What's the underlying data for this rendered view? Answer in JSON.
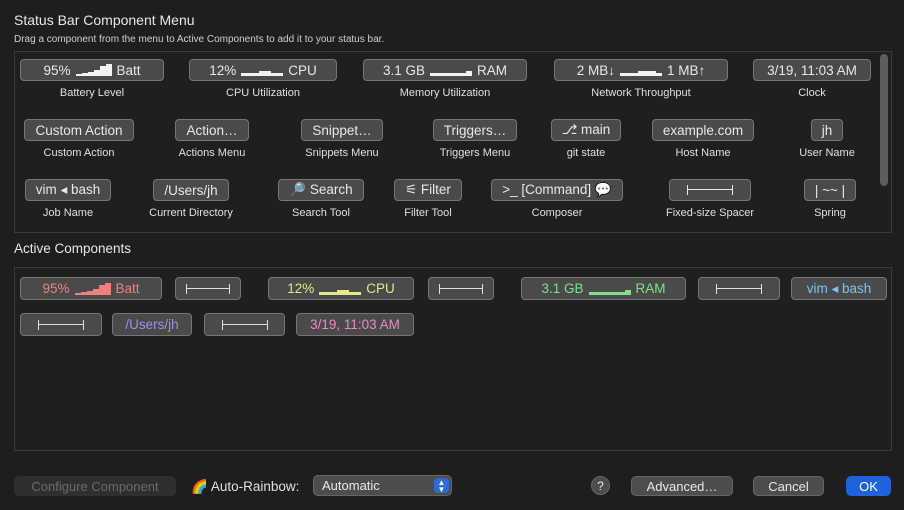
{
  "header": {
    "title": "Status Bar Component Menu",
    "subtitle": "Drag a component from the menu to Active Components to add it to your status bar."
  },
  "menu": {
    "row1": [
      {
        "display_left": "95%",
        "display_right": "Batt",
        "caption": "Battery Level"
      },
      {
        "display_left": "12%",
        "display_right": "CPU",
        "caption": "CPU Utilization"
      },
      {
        "display_left": "3.1 GB",
        "display_right": "RAM",
        "caption": "Memory Utilization"
      },
      {
        "display_left": "2 MB↓",
        "display_right": "1 MB↑",
        "caption": "Network Throughput"
      },
      {
        "display": "3/19, 11:03 AM",
        "caption": "Clock"
      }
    ],
    "row2": [
      {
        "display": "Custom Action",
        "caption": "Custom Action"
      },
      {
        "display": "Action…",
        "caption": "Actions Menu"
      },
      {
        "display": "Snippet…",
        "caption": "Snippets Menu"
      },
      {
        "display": "Triggers…",
        "caption": "Triggers Menu"
      },
      {
        "display": "⎇ main",
        "caption": "git state"
      },
      {
        "display": "example.com",
        "caption": "Host Name"
      },
      {
        "display": "jh",
        "caption": "User Name"
      }
    ],
    "row3": [
      {
        "display": "vim ◂ bash",
        "caption": "Job Name"
      },
      {
        "display": "/Users/jh",
        "caption": "Current Directory"
      },
      {
        "display": "🔎 Search",
        "caption": "Search Tool"
      },
      {
        "display": "⚟ Filter",
        "caption": "Filter Tool"
      },
      {
        "display": ">_ [Command] 💬",
        "caption": "Composer"
      },
      {
        "display": "",
        "caption": "Fixed-size Spacer"
      },
      {
        "display": "| ~~ |",
        "caption": "Spring"
      }
    ]
  },
  "active": {
    "title": "Active Components",
    "battery": {
      "left": "95%",
      "right": "Batt",
      "color": "#f08080"
    },
    "cpu": {
      "left": "12%",
      "right": "CPU",
      "color": "#e6e68a"
    },
    "ram": {
      "left": "3.1 GB",
      "right": "RAM",
      "color": "#7fe08a"
    },
    "job": {
      "text": "vim ◂ bash",
      "color": "#7cc4ec"
    },
    "dir": {
      "text": "/Users/jh",
      "color": "#a98ae8"
    },
    "clock": {
      "text": "3/19, 11:03 AM",
      "color": "#e88ac8"
    }
  },
  "footer": {
    "configure": "Configure Component",
    "rainbow_icon": "🌈",
    "rainbow_label": "Auto-Rainbow:",
    "select_value": "Automatic",
    "help": "?",
    "advanced": "Advanced…",
    "cancel": "Cancel",
    "ok": "OK"
  }
}
